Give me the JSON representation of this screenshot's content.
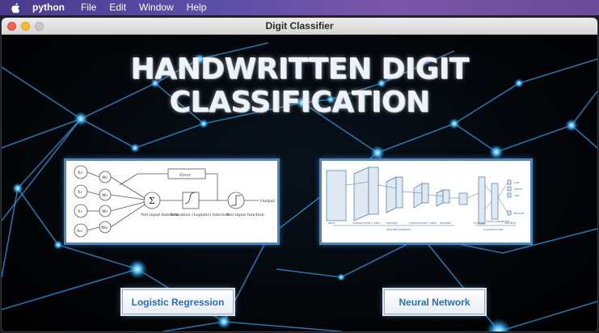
{
  "menubar": {
    "app_name": "python",
    "items": [
      "File",
      "Edit",
      "Window",
      "Help"
    ]
  },
  "window": {
    "title": "Digit Classifier"
  },
  "main": {
    "headline": "HANDWRITTEN DIGIT CLASSIFICATION",
    "logistic_diagram": {
      "inputs": [
        "x₀",
        "x₁",
        "x₂",
        "xₘ"
      ],
      "weights": [
        "w₀",
        "w₁",
        "w₂",
        "wₘ"
      ],
      "error_label": "Error",
      "sum_label": "Net input function",
      "activation_label": "Activation (Logistic) function",
      "threshold_label": "Net input function",
      "output_label": "Output"
    },
    "cnn_diagram": {
      "input_label": "INPUT",
      "conv1_label": "CONVOLUTION + RELU",
      "pool1_label": "POOLING",
      "conv2_label": "CONVOLUTION + RELU",
      "pool2_label": "POOLING",
      "flatten_label": "FLATTEN",
      "fc_label": "FULLY CONNECTED",
      "softmax_label": "SOFTMAX",
      "feature_learning_label": "FEATURE LEARNING",
      "classification_label": "CLASSIFICATION",
      "classes": [
        "CAR",
        "TRUCK",
        "VAN",
        "BICYCLE"
      ]
    },
    "buttons": {
      "logistic_regression": "Logistic Regression",
      "neural_network": "Neural Network"
    }
  },
  "colors": {
    "menubar_accent": "#5b4fa8",
    "panel_border": "#4f86c0",
    "button_text": "#2a6fb6",
    "node_glow": "#3fb4ff"
  }
}
